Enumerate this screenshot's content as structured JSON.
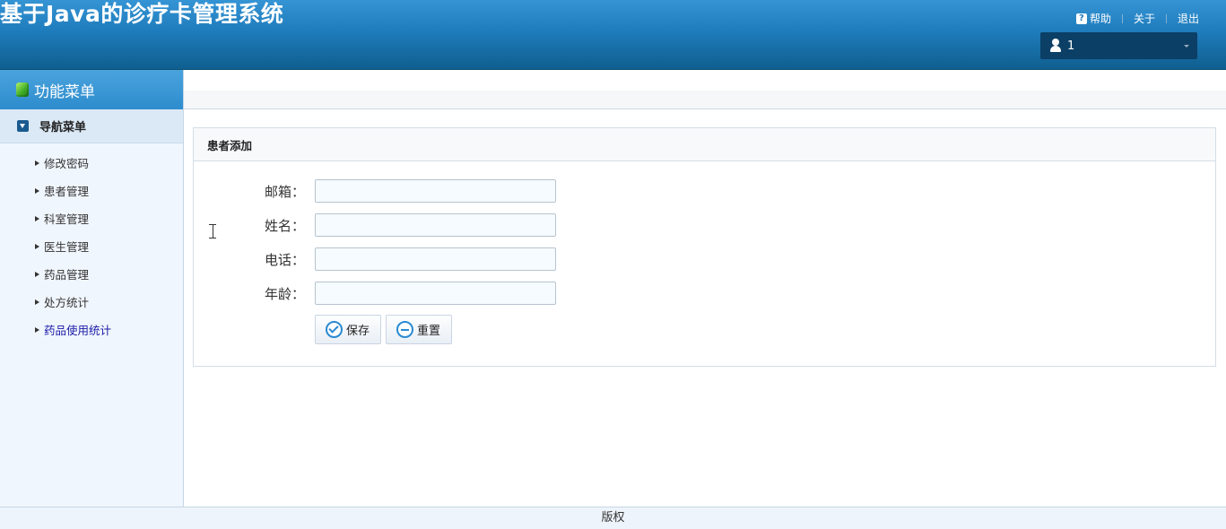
{
  "header": {
    "title": "基于Java的诊疗卡管理系统",
    "links": {
      "help": "帮助",
      "about": "关于",
      "logout": "退出"
    },
    "user": {
      "name": "1"
    }
  },
  "sidebar": {
    "title": "功能菜单",
    "nav_title": "导航菜单",
    "items": [
      {
        "label": "修改密码"
      },
      {
        "label": "患者管理"
      },
      {
        "label": "科室管理"
      },
      {
        "label": "医生管理"
      },
      {
        "label": "药品管理"
      },
      {
        "label": "处方统计"
      },
      {
        "label": "药品使用统计"
      }
    ]
  },
  "panel": {
    "title": "患者添加",
    "fields": {
      "email": {
        "label": "邮箱：",
        "value": ""
      },
      "name": {
        "label": "姓名：",
        "value": ""
      },
      "phone": {
        "label": "电话：",
        "value": ""
      },
      "age": {
        "label": "年龄：",
        "value": ""
      }
    },
    "buttons": {
      "save": "保存",
      "reset": "重置"
    }
  },
  "footer": {
    "text": "版权"
  }
}
